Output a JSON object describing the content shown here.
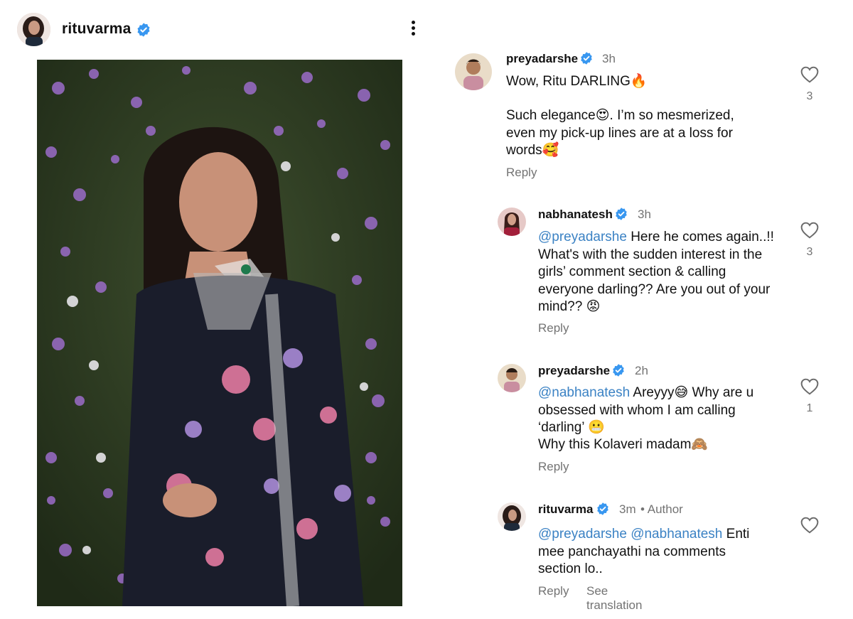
{
  "post": {
    "username": "rituvarma",
    "verified": true
  },
  "comments": [
    {
      "username": "preyadarshe",
      "time": "3h",
      "text_line1": "Wow, Ritu DARLING🔥",
      "text_line2": "Such elegance😍. I’m so mesmerized, even my pick-up lines are at a loss for words🥰",
      "reply": "Reply",
      "likes": "3"
    },
    {
      "username": "nabhanatesh",
      "time": "3h",
      "mention": "@preyadarshe",
      "text": " Here he comes again..!! What's with the sudden interest in the girls’ comment section & calling everyone darling?? Are you out of your mind?? 😡",
      "reply": "Reply",
      "likes": "3"
    },
    {
      "username": "preyadarshe",
      "time": "2h",
      "mention": "@nabhanatesh",
      "text": " Areyyy😅 Why are u obsessed with whom I am calling ‘darling’ 😬",
      "text_line2": "Why this Kolaveri madam🙈",
      "reply": "Reply",
      "likes": "1"
    },
    {
      "username": "rituvarma",
      "time": "3m",
      "author_label": "• Author",
      "mention1": "@preyadarshe",
      "mention2": "@nabhanatesh",
      "text": " Enti mee panchayathi na comments section lo..",
      "reply": "Reply",
      "see_translation": "See translation"
    }
  ],
  "colors": {
    "verified_blue": "#3897f0",
    "mention_blue": "#3b82c4",
    "secondary_gray": "#737373"
  },
  "icons": [
    "more-options-icon",
    "verified-badge-icon",
    "heart-icon"
  ]
}
